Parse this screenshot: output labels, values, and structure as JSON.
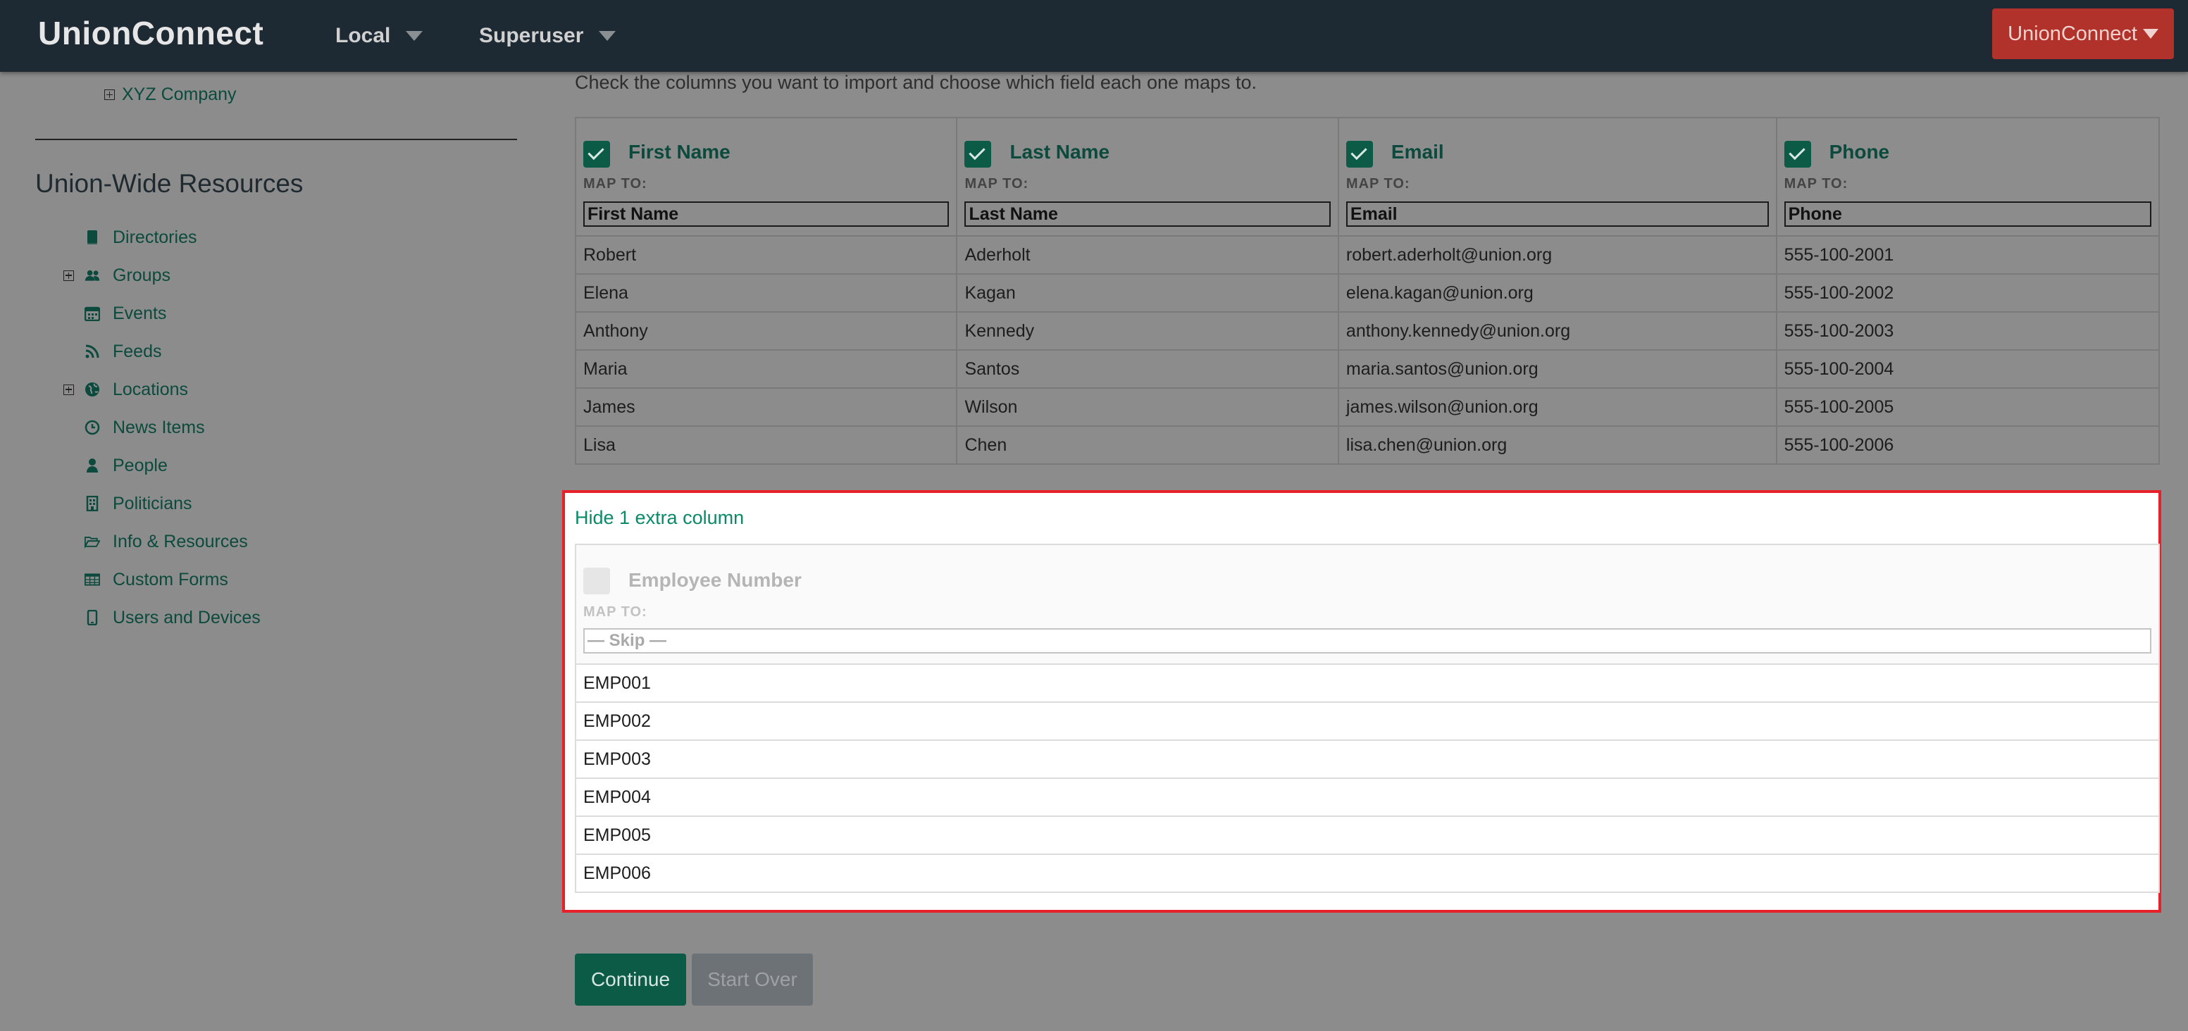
{
  "navbar": {
    "brand": "UnionConnect",
    "menu_local": "Local",
    "menu_superuser": "Superuser",
    "org_button": "UnionConnect"
  },
  "sidebar": {
    "top_item": "XYZ Company",
    "section_title": "Union-Wide Resources",
    "items": [
      {
        "label": "Directories",
        "icon": "book-icon",
        "expandable": false
      },
      {
        "label": "Groups",
        "icon": "users-icon",
        "expandable": true
      },
      {
        "label": "Events",
        "icon": "calendar-icon",
        "expandable": false
      },
      {
        "label": "Feeds",
        "icon": "rss-icon",
        "expandable": false
      },
      {
        "label": "Locations",
        "icon": "globe-icon",
        "expandable": true
      },
      {
        "label": "News Items",
        "icon": "clock-icon",
        "expandable": false
      },
      {
        "label": "People",
        "icon": "person-icon",
        "expandable": false
      },
      {
        "label": "Politicians",
        "icon": "building-icon",
        "expandable": false
      },
      {
        "label": "Info & Resources",
        "icon": "folder-open-icon",
        "expandable": false
      },
      {
        "label": "Custom Forms",
        "icon": "table-icon",
        "expandable": false
      },
      {
        "label": "Users and Devices",
        "icon": "mobile-icon",
        "expandable": false
      }
    ]
  },
  "main": {
    "instructions": "Check the columns you want to import and choose which field each one maps to.",
    "map_to_label": "MAP TO:",
    "columns": [
      {
        "name": "First Name",
        "checked": true,
        "map_to": "First Name"
      },
      {
        "name": "Last Name",
        "checked": true,
        "map_to": "Last Name"
      },
      {
        "name": "Email",
        "checked": true,
        "map_to": "Email"
      },
      {
        "name": "Phone",
        "checked": true,
        "map_to": "Phone"
      }
    ],
    "rows": [
      [
        "Robert",
        "Aderholt",
        "robert.aderholt@union.org",
        "555-100-2001"
      ],
      [
        "Elena",
        "Kagan",
        "elena.kagan@union.org",
        "555-100-2002"
      ],
      [
        "Anthony",
        "Kennedy",
        "anthony.kennedy@union.org",
        "555-100-2003"
      ],
      [
        "Maria",
        "Santos",
        "maria.santos@union.org",
        "555-100-2004"
      ],
      [
        "James",
        "Wilson",
        "james.wilson@union.org",
        "555-100-2005"
      ],
      [
        "Lisa",
        "Chen",
        "lisa.chen@union.org",
        "555-100-2006"
      ]
    ],
    "extra": {
      "toggle_label": "Hide 1 extra column",
      "column_name": "Employee Number",
      "checked": false,
      "map_to_label": "MAP TO:",
      "map_to": "— Skip —",
      "rows": [
        "EMP001",
        "EMP002",
        "EMP003",
        "EMP004",
        "EMP005",
        "EMP006"
      ]
    },
    "continue_button": "Continue",
    "start_over_button": "Start Over"
  },
  "colors": {
    "navbar_bg": "#1e2a33",
    "accent_green": "#0b5b47",
    "link_green": "#0b8a6a",
    "org_button_red": "#b0322a",
    "highlight_border": "#e8202a"
  }
}
